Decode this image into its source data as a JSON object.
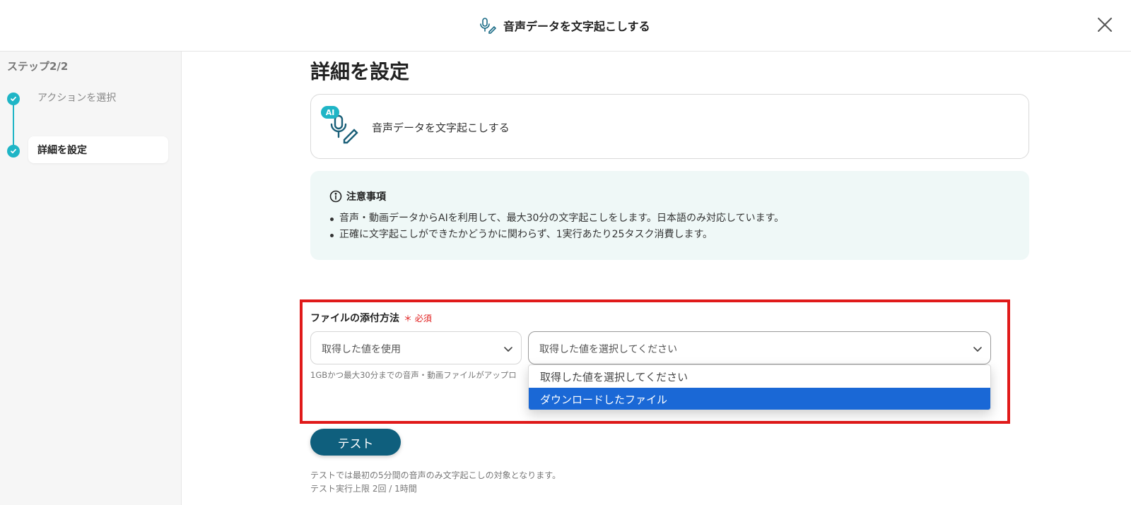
{
  "header": {
    "title": "音声データを文字起こしする",
    "icon": "mic-pen-icon",
    "close_icon": "close-icon"
  },
  "sidebar": {
    "step_label": "ステップ2/2",
    "steps": [
      {
        "label": "アクションを選択",
        "done": true
      },
      {
        "label": "詳細を設定",
        "done": true,
        "active": true
      }
    ]
  },
  "main": {
    "title": "詳細を設定",
    "action_card": {
      "badge": "AI",
      "label": "音声データを文字起こしする"
    },
    "notice": {
      "heading": "注意事項",
      "items": [
        "音声・動画データからAIを利用して、最大30分の文字起こしをします。日本語のみ対応しています。",
        "正確に文字起こしができたかどうかに関わらず、1実行あたり25タスク消費します。"
      ]
    },
    "field": {
      "label": "ファイルの添付方法",
      "required": "必須",
      "method_value": "取得した値を使用",
      "value_placeholder": "取得した値を選択してください",
      "hint": "1GBかつ最大30分までの音声・動画ファイルがアップロ",
      "dropdown_options": [
        "取得した値を選択してください",
        "ダウンロードしたファイル"
      ],
      "highlighted_option_index": 1
    },
    "test_button": "テスト",
    "footnotes": [
      "テストでは最初の5分間の音声のみ文字起こしの対象となります。",
      "テスト実行上限 2回 / 1時間"
    ]
  },
  "colors": {
    "accent_teal": "#1fb5c6",
    "button": "#0f5f7d",
    "highlight_red": "#e01a1a",
    "selected_option": "#1a68d6",
    "notice_bg": "#eff8f7"
  }
}
